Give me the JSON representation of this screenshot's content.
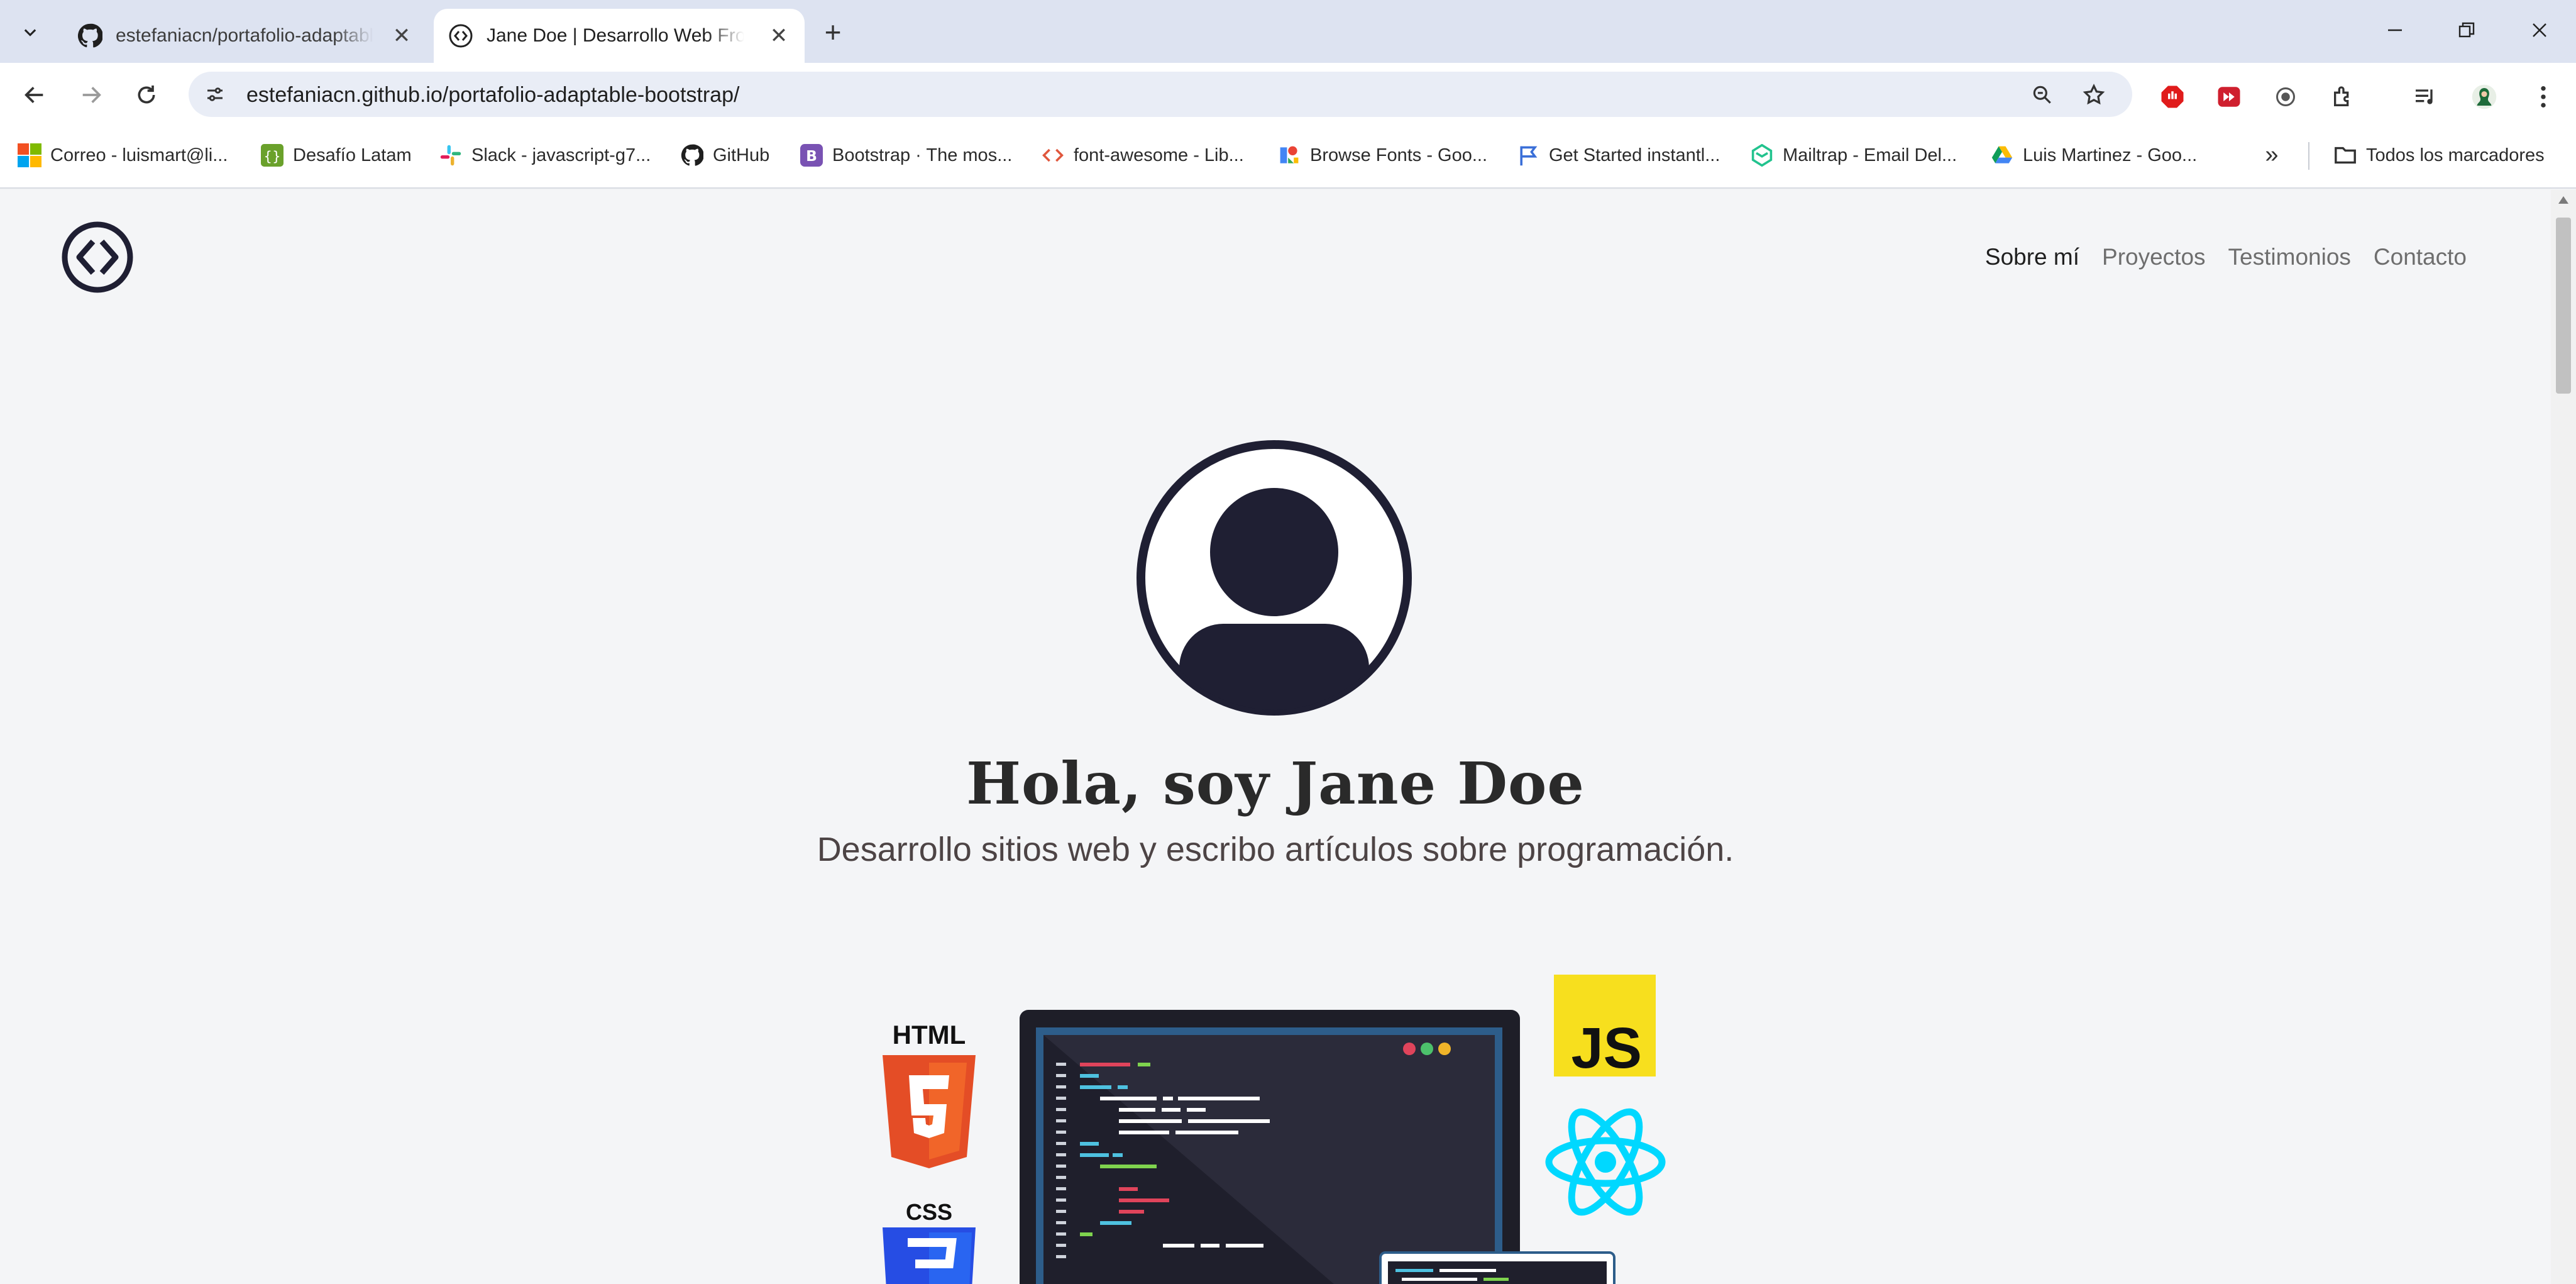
{
  "browser": {
    "tabs": [
      {
        "title": "estefaniacn/portafolio-adaptable-bootstrap",
        "favicon": "github-icon",
        "active": false
      },
      {
        "title": "Jane Doe | Desarrollo Web Front-End",
        "favicon": "code-brackets-icon",
        "active": true
      }
    ],
    "new_tab_label": "+",
    "url": "estefaniacn.github.io/portafolio-adaptable-bootstrap/",
    "bookmarks": [
      {
        "label": "Correo - luismart@li...",
        "icon": "microsoft-icon"
      },
      {
        "label": "Desafío Latam",
        "icon": "desafio-latam-icon"
      },
      {
        "label": "Slack - javascript-g7...",
        "icon": "slack-icon"
      },
      {
        "label": "GitHub",
        "icon": "github-icon"
      },
      {
        "label": "Bootstrap · The mos...",
        "icon": "bootstrap-icon"
      },
      {
        "label": "font-awesome - Lib...",
        "icon": "code-icon"
      },
      {
        "label": "Browse Fonts - Goo...",
        "icon": "google-fonts-icon"
      },
      {
        "label": "Get Started instantl...",
        "icon": "flag-icon"
      },
      {
        "label": "Mailtrap - Email Del...",
        "icon": "mailtrap-icon"
      },
      {
        "label": "Luis Martinez - Goo...",
        "icon": "google-drive-icon"
      }
    ],
    "all_bookmarks_label": "Todos los marcadores",
    "overflow_label": "»"
  },
  "site": {
    "nav": [
      {
        "label": "Sobre mí",
        "current": true
      },
      {
        "label": "Proyectos",
        "current": false
      },
      {
        "label": "Testimonios",
        "current": false
      },
      {
        "label": "Contacto",
        "current": false
      }
    ],
    "hero": {
      "title": "Hola, soy Jane Doe",
      "subtitle": "Desarrollo sitios web y escribo artículos sobre programación."
    },
    "illustration": {
      "html_label": "HTML",
      "css_label": "CSS",
      "js_label": "JS"
    }
  },
  "colors": {
    "tabstrip": "#dde3f1",
    "page_bg": "#f4f5f7",
    "dark_navy": "#1f1f33",
    "html_orange": "#e44d26",
    "css_blue": "#264de4",
    "js_yellow": "#f7df1e",
    "react_cyan": "#00d8ff"
  }
}
